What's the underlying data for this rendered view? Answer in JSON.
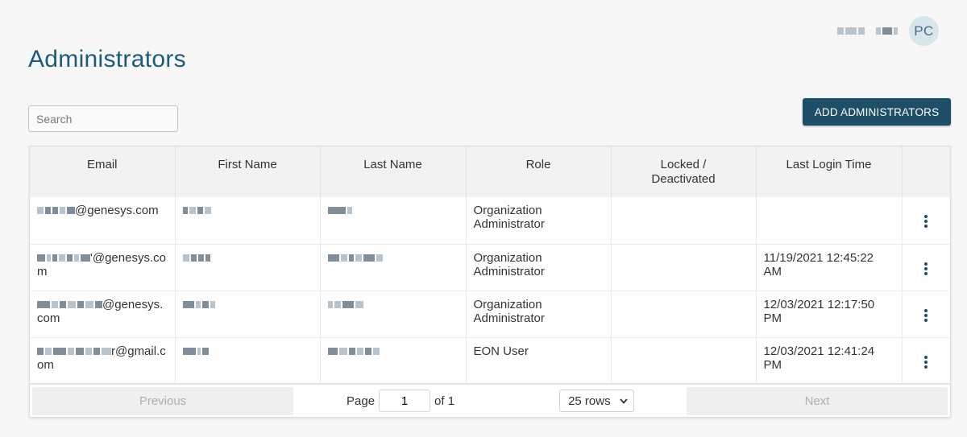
{
  "header": {
    "avatar_initials": "PC"
  },
  "page": {
    "title": "Administrators"
  },
  "search": {
    "placeholder": "Search"
  },
  "actions": {
    "add_label": "ADD ADMINISTRATORS"
  },
  "table": {
    "columns": [
      "Email",
      "First Name",
      "Last Name",
      "Role",
      "Locked / Deactivated",
      "Last Login Time"
    ],
    "rows": [
      {
        "email": "@genesys.com",
        "role": "Organization Administrator",
        "locked": "",
        "last_login": ""
      },
      {
        "email": "'@genesys.com",
        "role": "Organization Administrator",
        "locked": "",
        "last_login": "11/19/2021 12:45:22 AM"
      },
      {
        "email": "@genesys.com",
        "role": "Organization Administrator",
        "locked": "",
        "last_login": "12/03/2021 12:17:50 PM"
      },
      {
        "email": "r@gmail.com",
        "role": "EON User",
        "locked": "",
        "last_login": "12/03/2021 12:41:24 PM"
      }
    ]
  },
  "pagination": {
    "previous_label": "Previous",
    "next_label": "Next",
    "page_label": "Page",
    "current_page": "1",
    "of_label": "of 1",
    "rows_label": "25 rows"
  },
  "colors": {
    "accent": "#1f4f68",
    "title": "#1f5a78"
  },
  "icons": {
    "search": "magnifier",
    "row_menu": "kebab-vertical",
    "rows_dropdown": "chevron-down"
  }
}
